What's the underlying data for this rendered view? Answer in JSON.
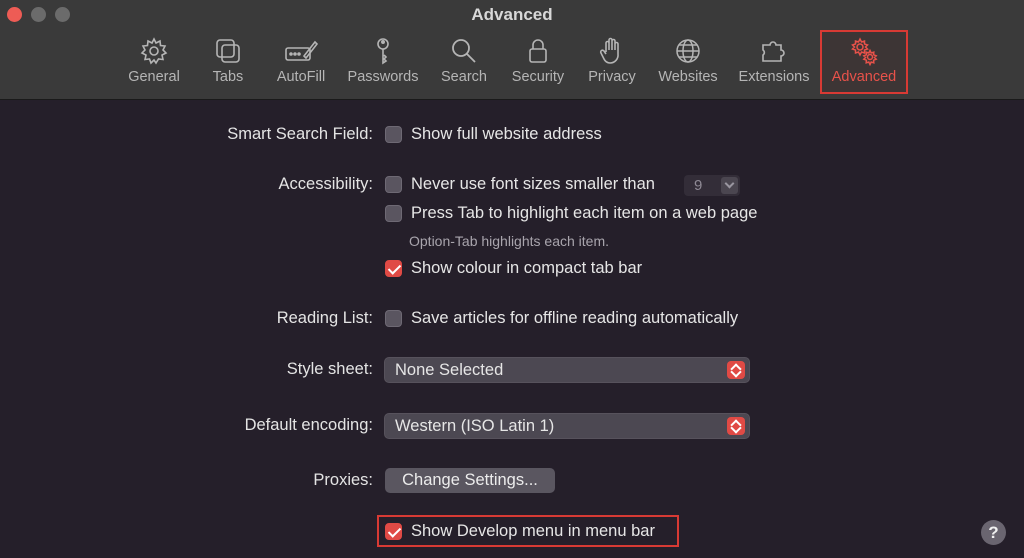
{
  "window": {
    "title": "Advanced"
  },
  "tabs": [
    {
      "label": "General",
      "icon": "gear-icon"
    },
    {
      "label": "Tabs",
      "icon": "tabs-icon"
    },
    {
      "label": "AutoFill",
      "icon": "autofill-icon"
    },
    {
      "label": "Passwords",
      "icon": "key-icon"
    },
    {
      "label": "Search",
      "icon": "search-icon"
    },
    {
      "label": "Security",
      "icon": "lock-icon"
    },
    {
      "label": "Privacy",
      "icon": "hand-icon"
    },
    {
      "label": "Websites",
      "icon": "globe-icon"
    },
    {
      "label": "Extensions",
      "icon": "puzzle-icon"
    },
    {
      "label": "Advanced",
      "icon": "gears-icon",
      "active": true
    }
  ],
  "settings": {
    "smart_search": {
      "label": "Smart Search Field:",
      "option": "Show full website address",
      "checked": false
    },
    "accessibility": {
      "label": "Accessibility:",
      "font_option": "Never use font sizes smaller than",
      "font_size": "9",
      "tab_option": "Press Tab to highlight each item on a web page",
      "tab_hint": "Option-Tab highlights each item.",
      "colour_option": "Show colour in compact tab bar",
      "colour_checked": true
    },
    "reading_list": {
      "label": "Reading List:",
      "option": "Save articles for offline reading automatically"
    },
    "style_sheet": {
      "label": "Style sheet:",
      "value": "None Selected"
    },
    "encoding": {
      "label": "Default encoding:",
      "value": "Western (ISO Latin 1)"
    },
    "proxies": {
      "label": "Proxies:",
      "button": "Change Settings..."
    },
    "develop": {
      "option": "Show Develop menu in menu bar",
      "checked": true
    }
  },
  "help": {
    "label": "?"
  },
  "colors": {
    "accent": "#e04a45",
    "background": "#251f2a",
    "toolbar": "#3a3a3a"
  }
}
